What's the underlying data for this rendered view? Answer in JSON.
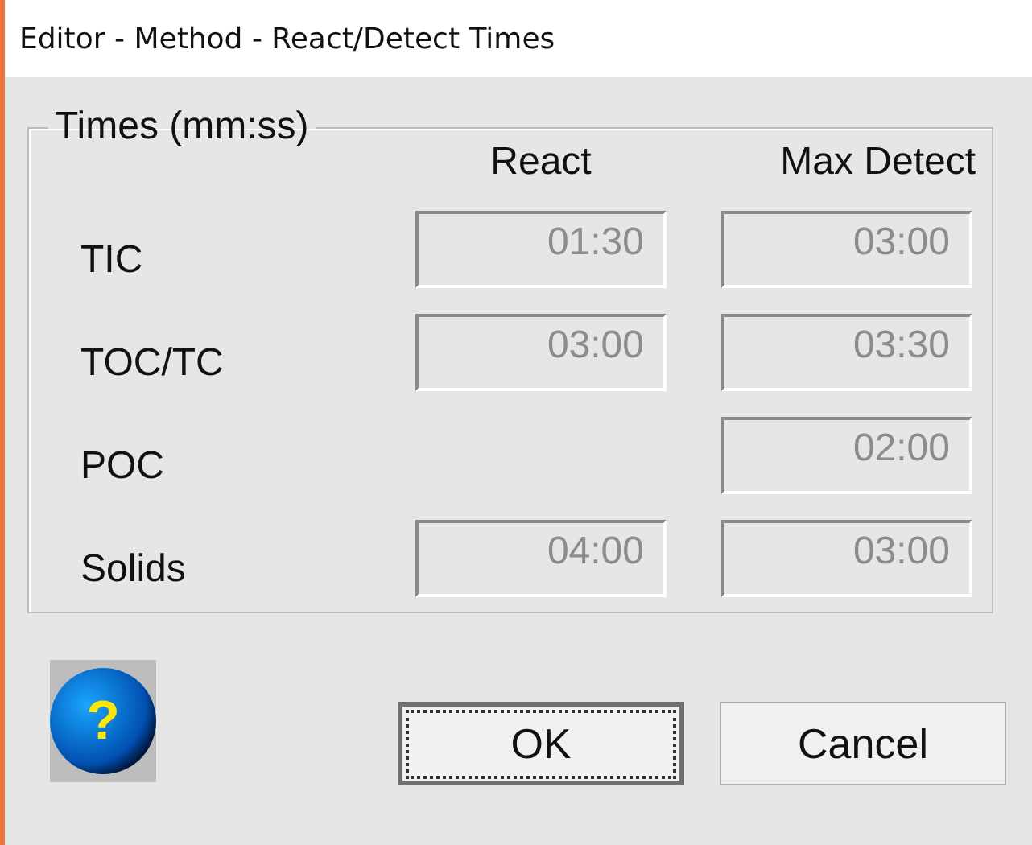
{
  "window": {
    "title": "Editor - Method - React/Detect Times"
  },
  "group": {
    "title": "Times (mm:ss)",
    "columns": [
      "React",
      "Max Detect"
    ],
    "rows": [
      {
        "label": "TIC",
        "react": "01:30",
        "max_detect": "03:00",
        "disabled": true
      },
      {
        "label": "TOC/TC",
        "react": "03:00",
        "max_detect": "03:30",
        "disabled": true
      },
      {
        "label": "POC",
        "max_detect": "02:00",
        "disabled": true
      },
      {
        "label": "Solids",
        "react": "04:00",
        "max_detect": "03:00",
        "disabled": true
      }
    ]
  },
  "help": {
    "label": "?"
  },
  "buttons": [
    {
      "label": "OK",
      "selected": true
    },
    {
      "label": "Cancel",
      "selected": false
    }
  ]
}
